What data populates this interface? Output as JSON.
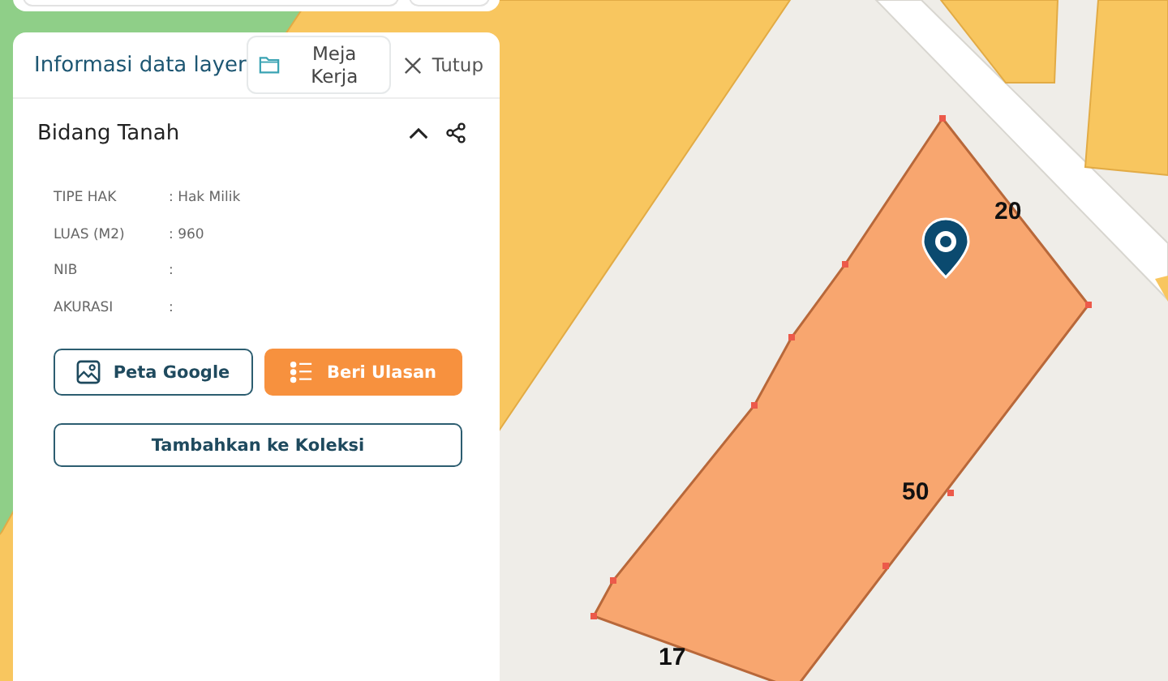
{
  "panel": {
    "title": "Informasi data layer",
    "workspace_button": "Meja Kerja",
    "close_button": "Tutup"
  },
  "section": {
    "title": "Bidang Tanah",
    "expanded": true,
    "attributes": [
      {
        "label": "TIPE HAK",
        "value": ": Hak Milik"
      },
      {
        "label": "LUAS (M2)",
        "value": ": 960"
      },
      {
        "label": "NIB",
        "value": ":"
      },
      {
        "label": "AKURASI",
        "value": ":"
      }
    ],
    "buttons": [
      {
        "label": "Peta Google",
        "kind": "outline"
      },
      {
        "label": "Beri Ulasan",
        "kind": "filled"
      }
    ],
    "collection_button": "Tambahkan ke Koleksi"
  },
  "map": {
    "labels": [
      {
        "text": "20"
      },
      {
        "text": "50"
      },
      {
        "text": "17"
      }
    ]
  }
}
